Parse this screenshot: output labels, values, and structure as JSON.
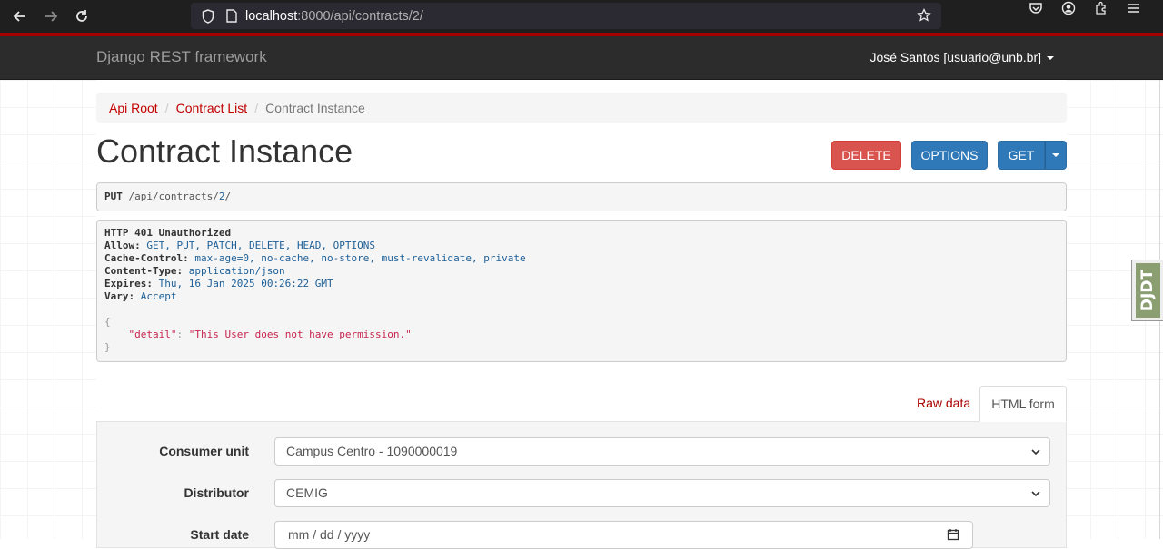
{
  "browser": {
    "url_host": "localhost",
    "url_path": ":8000/api/contracts/2/"
  },
  "navbar": {
    "brand": "Django REST framework",
    "user": "José Santos [usuario@unb.br]"
  },
  "breadcrumb": {
    "items": [
      "Api Root",
      "Contract List"
    ],
    "active": "Contract Instance"
  },
  "page_title": "Contract Instance",
  "actions": {
    "delete": "DELETE",
    "options": "OPTIONS",
    "get": "GET"
  },
  "request": {
    "method": "PUT",
    "path_prefix": " /api/contracts/",
    "path_id": "2",
    "path_suffix": "/"
  },
  "response": {
    "status": "HTTP 401 Unauthorized",
    "headers": [
      {
        "name": "Allow:",
        "value": "GET, PUT, PATCH, DELETE, HEAD, OPTIONS"
      },
      {
        "name": "Cache-Control:",
        "value": "max-age=0, no-cache, no-store, must-revalidate, private"
      },
      {
        "name": "Content-Type:",
        "value": "application/json"
      },
      {
        "name": "Expires:",
        "value": "Thu, 16 Jan 2025 00:26:22 GMT"
      },
      {
        "name": "Vary:",
        "value": "Accept"
      }
    ],
    "body_key": "\"detail\"",
    "body_value": "\"This User does not have permission.\""
  },
  "form_tabs": {
    "raw": "Raw data",
    "html": "HTML form"
  },
  "form": {
    "consumer_unit_label": "Consumer unit",
    "consumer_unit_value": "Campus Centro - 1090000019",
    "distributor_label": "Distributor",
    "distributor_value": "CEMIG",
    "start_date_label": "Start date",
    "start_date_placeholder": "mm / dd / yyyy"
  },
  "djdt": {
    "label": "DJDT"
  },
  "colors": {
    "danger": "#d9534f",
    "primary": "#2f79b9",
    "link": "#c20000",
    "navbar": "#2c2c2c"
  }
}
